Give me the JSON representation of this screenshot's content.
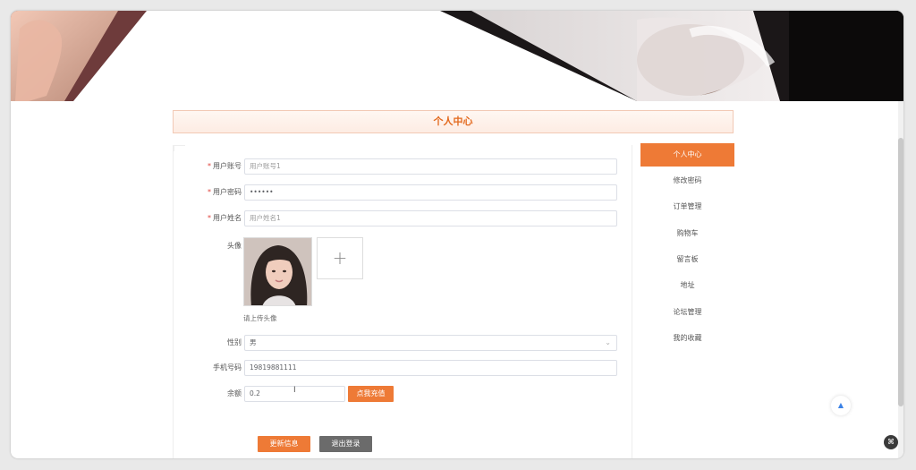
{
  "page": {
    "title": "个人中心"
  },
  "form": {
    "username": {
      "label": "用户账号",
      "value": "用户账号1"
    },
    "password": {
      "label": "用户密码",
      "value": "••••••"
    },
    "name": {
      "label": "用户姓名",
      "value": "用户姓名1"
    },
    "avatar": {
      "label": "头像",
      "upload_icon": "plus-icon",
      "hint": "请上传头像",
      "upload_symbol": "+"
    },
    "gender": {
      "label": "性别",
      "value": "男",
      "dropdown_icon": "chevron-down-icon",
      "dropdown_symbol": "⌄"
    },
    "phone": {
      "label": "手机号码",
      "value": "19819881111"
    },
    "balance": {
      "label": "余额",
      "value": "0.2",
      "recharge_label": "点我充值"
    },
    "required_mark": "*"
  },
  "actions": {
    "update_label": "更新信息",
    "logout_label": "退出登录"
  },
  "side_menu": {
    "items": [
      {
        "label": "个人中心",
        "active": true
      },
      {
        "label": "修改密码",
        "active": false
      },
      {
        "label": "订单管理",
        "active": false
      },
      {
        "label": "购物车",
        "active": false
      },
      {
        "label": "留言板",
        "active": false
      },
      {
        "label": "地址",
        "active": false
      },
      {
        "label": "论坛管理",
        "active": false
      },
      {
        "label": "我的收藏",
        "active": false
      }
    ]
  },
  "widgets": {
    "back_to_top_icon": "arrow-up-icon",
    "back_to_top_symbol": "▲",
    "corner_icon": "scan-icon",
    "corner_symbol": "⌘"
  },
  "colors": {
    "accent": "#ee7a36",
    "title_text": "#e36a1f",
    "gray_button": "#6b6b6b",
    "required": "#e0433c"
  }
}
